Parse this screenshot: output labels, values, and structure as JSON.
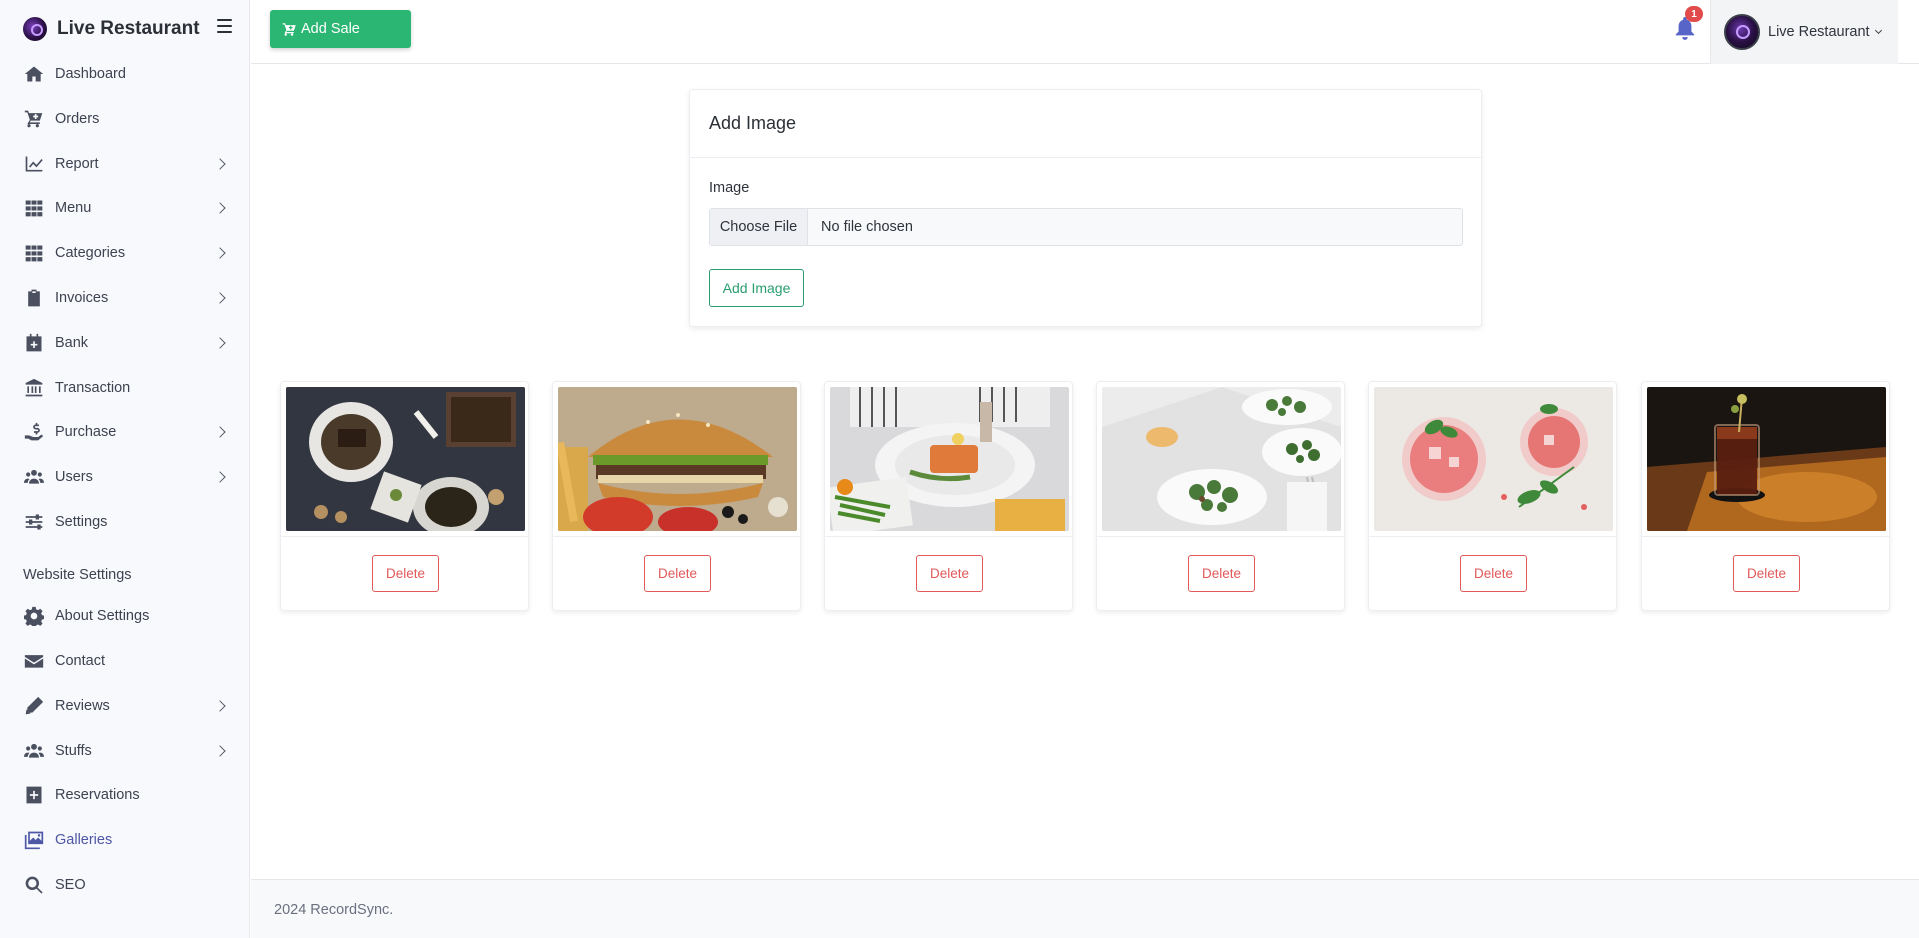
{
  "brand": {
    "name": "Live Restaurant"
  },
  "sidebar": {
    "items": [
      {
        "label": "Dashboard",
        "icon": "home-icon",
        "has_submenu": false
      },
      {
        "label": "Orders",
        "icon": "cart-plus-icon",
        "has_submenu": false
      },
      {
        "label": "Report",
        "icon": "chart-line-icon",
        "has_submenu": true
      },
      {
        "label": "Menu",
        "icon": "grid-icon",
        "has_submenu": true
      },
      {
        "label": "Categories",
        "icon": "grid-icon",
        "has_submenu": true
      },
      {
        "label": "Invoices",
        "icon": "clipboard-check-icon",
        "has_submenu": true
      },
      {
        "label": "Bank",
        "icon": "calendar-plus-icon",
        "has_submenu": true
      },
      {
        "label": "Transaction",
        "icon": "bank-icon",
        "has_submenu": false
      },
      {
        "label": "Purchase",
        "icon": "hand-dollar-icon",
        "has_submenu": true
      },
      {
        "label": "Users",
        "icon": "users-icon",
        "has_submenu": true
      },
      {
        "label": "Settings",
        "icon": "sliders-icon",
        "has_submenu": false
      }
    ],
    "website_heading": "Website Settings",
    "website_items": [
      {
        "label": "About Settings",
        "icon": "gear-icon",
        "has_submenu": false
      },
      {
        "label": "Contact",
        "icon": "envelope-icon",
        "has_submenu": false
      },
      {
        "label": "Reviews",
        "icon": "pencil-icon",
        "has_submenu": true
      },
      {
        "label": "Stuffs",
        "icon": "users-icon",
        "has_submenu": true
      },
      {
        "label": "Reservations",
        "icon": "plus-square-icon",
        "has_submenu": false
      },
      {
        "label": "Galleries",
        "icon": "images-icon",
        "has_submenu": false,
        "active": true
      },
      {
        "label": "SEO",
        "icon": "search-icon",
        "has_submenu": false
      }
    ]
  },
  "topbar": {
    "add_sale_label": "Add Sale",
    "notification_count": "1",
    "user_name": "Live Restaurant"
  },
  "add_image": {
    "title": "Add Image",
    "field_label": "Image",
    "choose_file_label": "Choose File",
    "file_status": "No file chosen",
    "submit_label": "Add Image"
  },
  "gallery": {
    "delete_label": "Delete",
    "images": [
      {
        "subject": "grilled-dish-photo"
      },
      {
        "subject": "burger-photo"
      },
      {
        "subject": "salmon-plate-photo"
      },
      {
        "subject": "salad-plates-photo"
      },
      {
        "subject": "pink-drinks-photo"
      },
      {
        "subject": "cocktail-photo"
      }
    ]
  },
  "footer": {
    "text": "2024 RecordSync."
  },
  "colors": {
    "accent_green": "#2bb673",
    "active_nav": "#4d57a5",
    "danger": "#e05a5a",
    "badge": "#e24b4b"
  }
}
